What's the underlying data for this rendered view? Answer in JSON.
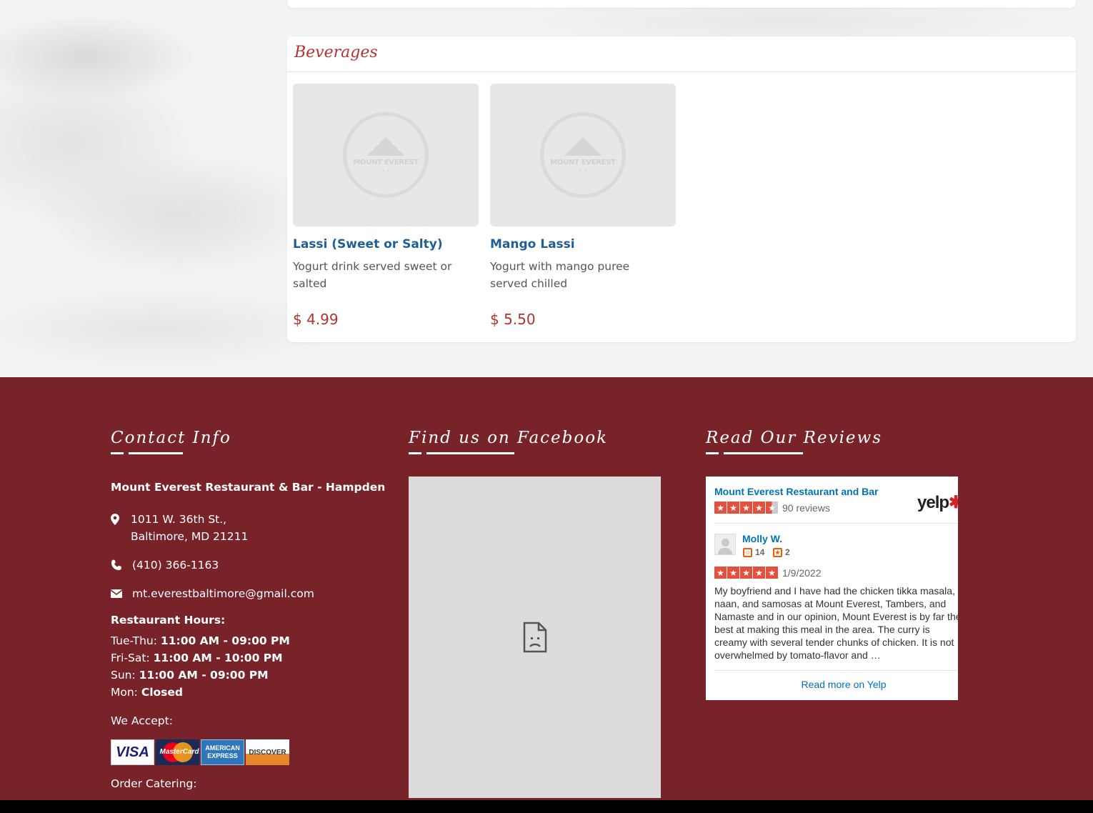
{
  "section": {
    "title": "Beverages",
    "items": [
      {
        "name": "Lassi (Sweet or Salty)",
        "description": "Yogurt drink served sweet or salted",
        "price": "$ 4.99",
        "image_logo": "MOUNT EVEREST"
      },
      {
        "name": "Mango Lassi",
        "description": "Yogurt with mango puree served chilled",
        "price": "$ 5.50",
        "image_logo": "MOUNT EVEREST"
      }
    ]
  },
  "footer": {
    "contact": {
      "title": "Contact Info",
      "business_name": "Mount Everest Restaurant & Bar - Hampden",
      "address_line1": "1011 W. 36th St.,",
      "address_line2": "Baltimore, MD 21211",
      "phone": "(410) 366-1163",
      "email": "mt.everestbaltimore@gmail.com",
      "hours_title": "Restaurant Hours:",
      "hours": [
        {
          "days": "Tue-Thu:",
          "time": "11:00 AM - 09:00 PM"
        },
        {
          "days": "Fri-Sat:",
          "time": "11:00 AM - 10:00 PM"
        },
        {
          "days": "Sun:",
          "time": "11:00 AM - 09:00 PM"
        },
        {
          "days": "Mon:",
          "time": "Closed"
        }
      ],
      "we_accept_label": "We Accept:",
      "cards": [
        "VISA",
        "MasterCard",
        "AMERICAN EXPRESS",
        "DISCOVER"
      ],
      "order_catering_label": "Order Catering:"
    },
    "facebook": {
      "title": "Find us on Facebook"
    },
    "reviews": {
      "title": "Read Our Reviews",
      "business": "Mount Everest Restaurant and Bar",
      "review_count": "90 reviews",
      "rating": 4.5,
      "logo": "yelp",
      "reviewer": "Molly W.",
      "reviewer_friends": "14",
      "reviewer_reviews": "2",
      "review_rating": 5,
      "review_date": "1/9/2022",
      "review_text": "My boyfriend and I have had the chicken tikka masala, naan, and samosas at Mount Everest, Tambers, and Namaste and in our opinion, Mount Everest is by far the best at making this meal in the area. The curry is creamy with several tender chunks of chicken. It is not overwhelmed by tomato-flavor and …",
      "read_more": "Read more on Yelp"
    }
  },
  "colors": {
    "footer_bg": "#772329",
    "accent_red": "#b63232",
    "item_name_blue": "#1f5e96",
    "yelp_red": "#e3503e",
    "yelp_link": "#0073bb"
  }
}
